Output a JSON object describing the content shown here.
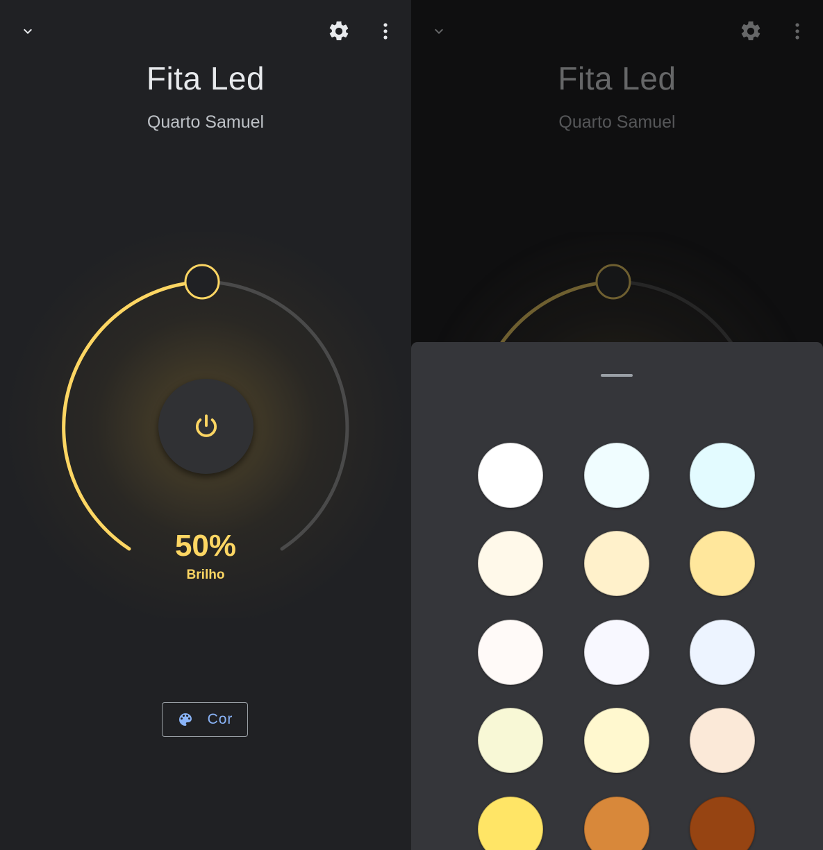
{
  "device": {
    "name": "Fita Led",
    "room": "Quarto Samuel"
  },
  "brightness": {
    "value_text": "50%",
    "label": "Brilho",
    "level_fraction": 0.5
  },
  "color_button": {
    "label": "Cor"
  },
  "icons": {
    "collapse": "chevron-down-icon",
    "settings": "gear-icon",
    "more": "more-vert-icon",
    "power": "power-icon",
    "palette": "palette-icon"
  },
  "colors": {
    "accent": "#fdd663",
    "link": "#8ab4f8",
    "background": "#202124",
    "sheet": "#35363a"
  },
  "color_swatches": [
    "#ffffff",
    "#f0fdff",
    "#e3fbff",
    "#fff9ea",
    "#fff1cb",
    "#ffe79c",
    "#fffaf8",
    "#f8f8ff",
    "#edf4ff",
    "#f8f8d6",
    "#fff8cf",
    "#fbe9d8",
    "#ffe566",
    "#d8883a",
    "#964412"
  ]
}
